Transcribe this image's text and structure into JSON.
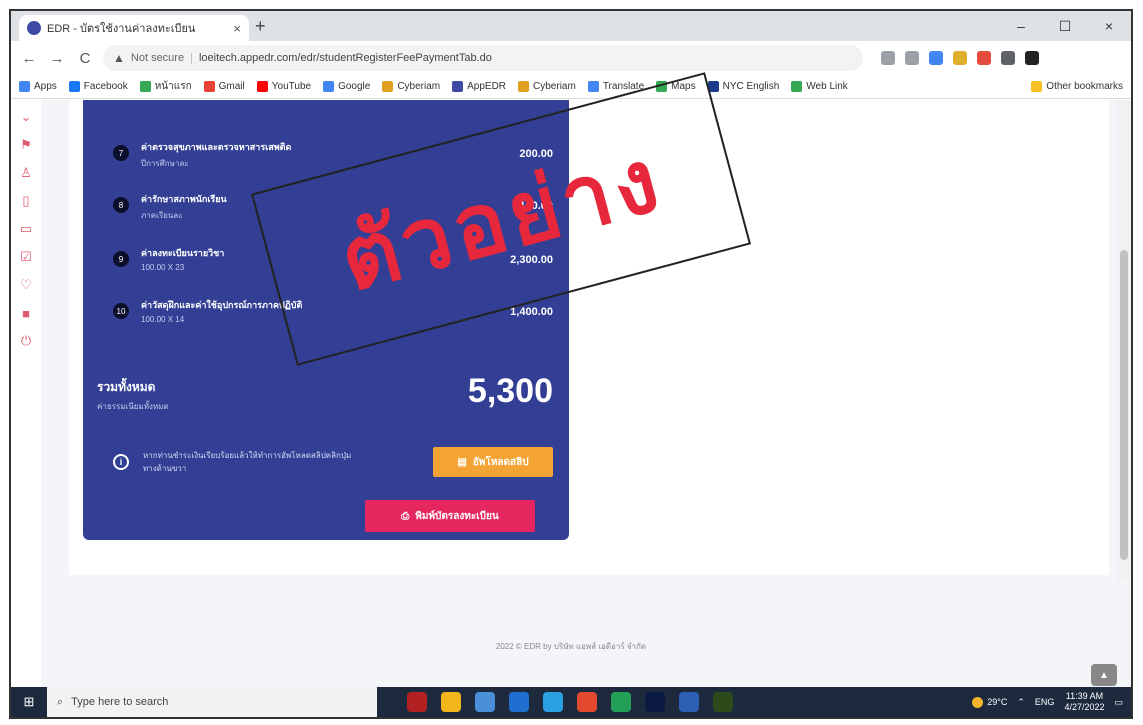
{
  "browser": {
    "tab_title": "EDR - บัตรใช้งานค่าลงทะเบียน",
    "tab_close": "×",
    "new_tab": "+",
    "window_controls": [
      "–",
      "☐",
      "×"
    ],
    "nav": [
      "←",
      "→",
      "C"
    ],
    "security": "Not secure",
    "url": "loeitech.appedr.com/edr/studentRegisterFeePaymentTab.do"
  },
  "bookmarks": {
    "items": [
      "Apps",
      "Facebook",
      "หน้าแรก",
      "Gmail",
      "YouTube",
      "Google",
      "Cyberiam",
      "AppEDR",
      "Cyberiam",
      "Translate",
      "Maps",
      "NYC English",
      "Web Link"
    ],
    "other": "Other bookmarks"
  },
  "panel": {
    "items": [
      {
        "num": "7",
        "name": "ค่าตรวจสุขภาพและตรวจหาสารเสพติด",
        "sub": "ปีการศึกษาละ",
        "amount": "200.00"
      },
      {
        "num": "8",
        "name": "ค่ารักษาสภาพนักเรียน",
        "sub": "ภาคเรียนละ",
        "amount": "100.00"
      },
      {
        "num": "9",
        "name": "ค่าลงทะเบียนรายวิชา",
        "sub": "100.00 X 23",
        "amount": "2,300.00"
      },
      {
        "num": "10",
        "name": "ค่าวัสดุฝึกและค่าใช้อุปกรณ์การภาคปฏิบัติ",
        "sub": "100.00 X 14",
        "amount": "1,400.00"
      }
    ],
    "total_label": "รวมทั้งหมด",
    "total_sub": "ค่าธรรมเนียมทั้งหมด",
    "total_amount": "5,300",
    "info_text": "หากท่านชำระเงินเรียบร้อยแล้วให้ทำการอัพโหลดสลิปคลิกปุ่มทางด้านขวา",
    "upload_label": "อัพโหลดสลิป",
    "print_label": "พิมพ์บัตรลงทะเบียน",
    "stamp": "ตัวอย่าง"
  },
  "footer": "2022 © EDR by บริษัท แอพส์ เอดีอาร์ จำกัด",
  "taskbar": {
    "search_placeholder": "Type here to search",
    "temp": "29°C",
    "lang": "ENG",
    "time": "11:39 AM",
    "date": "4/27/2022"
  }
}
